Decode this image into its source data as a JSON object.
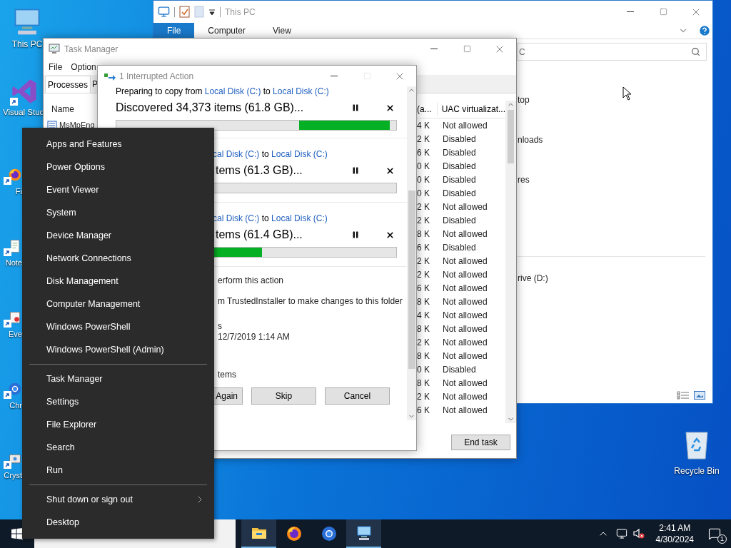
{
  "desktop_icons": [
    {
      "kind": "computer",
      "label": "This PC"
    },
    {
      "kind": "studio",
      "label": "Visual Stud"
    },
    {
      "kind": "firefox",
      "label": "Fi"
    },
    {
      "kind": "notepad",
      "label": "Note"
    },
    {
      "kind": "event",
      "label": "Eve"
    },
    {
      "kind": "chrome",
      "label": "Chr"
    },
    {
      "kind": "crystal",
      "label": "Cryst"
    }
  ],
  "recycle_bin": {
    "label": "Recycle Bin"
  },
  "explorer": {
    "title": "This PC",
    "ribbon_tabs": [
      {
        "label": "File",
        "selected": true
      },
      {
        "label": "Computer",
        "selected": false
      },
      {
        "label": "View",
        "selected": false
      }
    ],
    "search": "C",
    "folders": [
      "top",
      "nloads",
      "res"
    ],
    "drives": [
      "rive (D:)"
    ]
  },
  "task_manager": {
    "title": "Task Manager",
    "menu": [
      "File",
      "Option"
    ],
    "tabs": [
      {
        "label": "Processes",
        "selected": true
      },
      {
        "label": "P",
        "selected": false
      }
    ],
    "name_column": "Name",
    "first_process": "MsMpEng",
    "columns": [
      "(a...",
      "UAC virtualizat..."
    ],
    "rows": [
      [
        "4 K",
        "Not allowed"
      ],
      [
        "2 K",
        "Disabled"
      ],
      [
        "6 K",
        "Disabled"
      ],
      [
        "0 K",
        "Disabled"
      ],
      [
        "0 K",
        "Disabled"
      ],
      [
        "0 K",
        "Disabled"
      ],
      [
        "2 K",
        "Not allowed"
      ],
      [
        "2 K",
        "Disabled"
      ],
      [
        "8 K",
        "Not allowed"
      ],
      [
        "6 K",
        "Disabled"
      ],
      [
        "2 K",
        "Not allowed"
      ],
      [
        "2 K",
        "Not allowed"
      ],
      [
        "6 K",
        "Not allowed"
      ],
      [
        "8 K",
        "Not allowed"
      ],
      [
        "4 K",
        "Not allowed"
      ],
      [
        "8 K",
        "Not allowed"
      ],
      [
        "2 K",
        "Not allowed"
      ],
      [
        "8 K",
        "Not allowed"
      ],
      [
        "0 K",
        "Disabled"
      ],
      [
        "8 K",
        "Not allowed"
      ],
      [
        "2 K",
        "Not allowed"
      ],
      [
        "6 K",
        "Not allowed"
      ]
    ],
    "end_task": "End task"
  },
  "dialog": {
    "title": "1 Interrupted Action",
    "operations": [
      {
        "kind": "marquee",
        "prefix": "Preparing to copy from ",
        "source": "Local Disk (C:)",
        "middle": " to ",
        "target": "Local Disk (C:)",
        "status": "Discovered 34,373 items (61.8 GB)..."
      },
      {
        "kind": "progress",
        "level": 0,
        "source": "cal Disk (C:)",
        "middle": " to ",
        "target": "Local Disk (C:)",
        "status": "tems (61.3 GB)..."
      },
      {
        "kind": "progress",
        "level": 0.52,
        "source": "cal Disk (C:)",
        "middle": " to ",
        "target": "Local Disk (C:)",
        "status": "tems (61.4 GB)..."
      }
    ],
    "details": [
      "erform this action",
      "m TrustedInstaller to make changes to this folder",
      "s",
      "12/7/2019 1:14 AM",
      "tems"
    ],
    "buttons": [
      "Again",
      "Skip",
      "Cancel"
    ]
  },
  "start_menu": {
    "groups": [
      [
        {
          "label": "Apps and Features",
          "submenu": false
        },
        {
          "label": "Power Options",
          "submenu": false
        },
        {
          "label": "Event Viewer",
          "submenu": false
        },
        {
          "label": "System",
          "submenu": false
        },
        {
          "label": "Device Manager",
          "submenu": false
        },
        {
          "label": "Network Connections",
          "submenu": false
        },
        {
          "label": "Disk Management",
          "submenu": false
        },
        {
          "label": "Computer Management",
          "submenu": false
        },
        {
          "label": "Windows PowerShell",
          "submenu": false
        },
        {
          "label": "Windows PowerShell (Admin)",
          "submenu": false
        }
      ],
      [
        {
          "label": "Task Manager",
          "submenu": false
        },
        {
          "label": "Settings",
          "submenu": false
        },
        {
          "label": "File Explorer",
          "submenu": false
        },
        {
          "label": "Search",
          "submenu": false
        },
        {
          "label": "Run",
          "submenu": false
        }
      ],
      [
        {
          "label": "Shut down or sign out",
          "submenu": true
        },
        {
          "label": "Desktop",
          "submenu": false
        }
      ]
    ]
  },
  "taskbar": {
    "apps": [
      {
        "kind": "folder",
        "active": true
      },
      {
        "kind": "firefox",
        "active": false
      },
      {
        "kind": "chrome",
        "active": false
      },
      {
        "kind": "monitor",
        "active": true
      }
    ],
    "time": "2:41 AM",
    "date": "4/30/2024",
    "notifications": "1"
  }
}
